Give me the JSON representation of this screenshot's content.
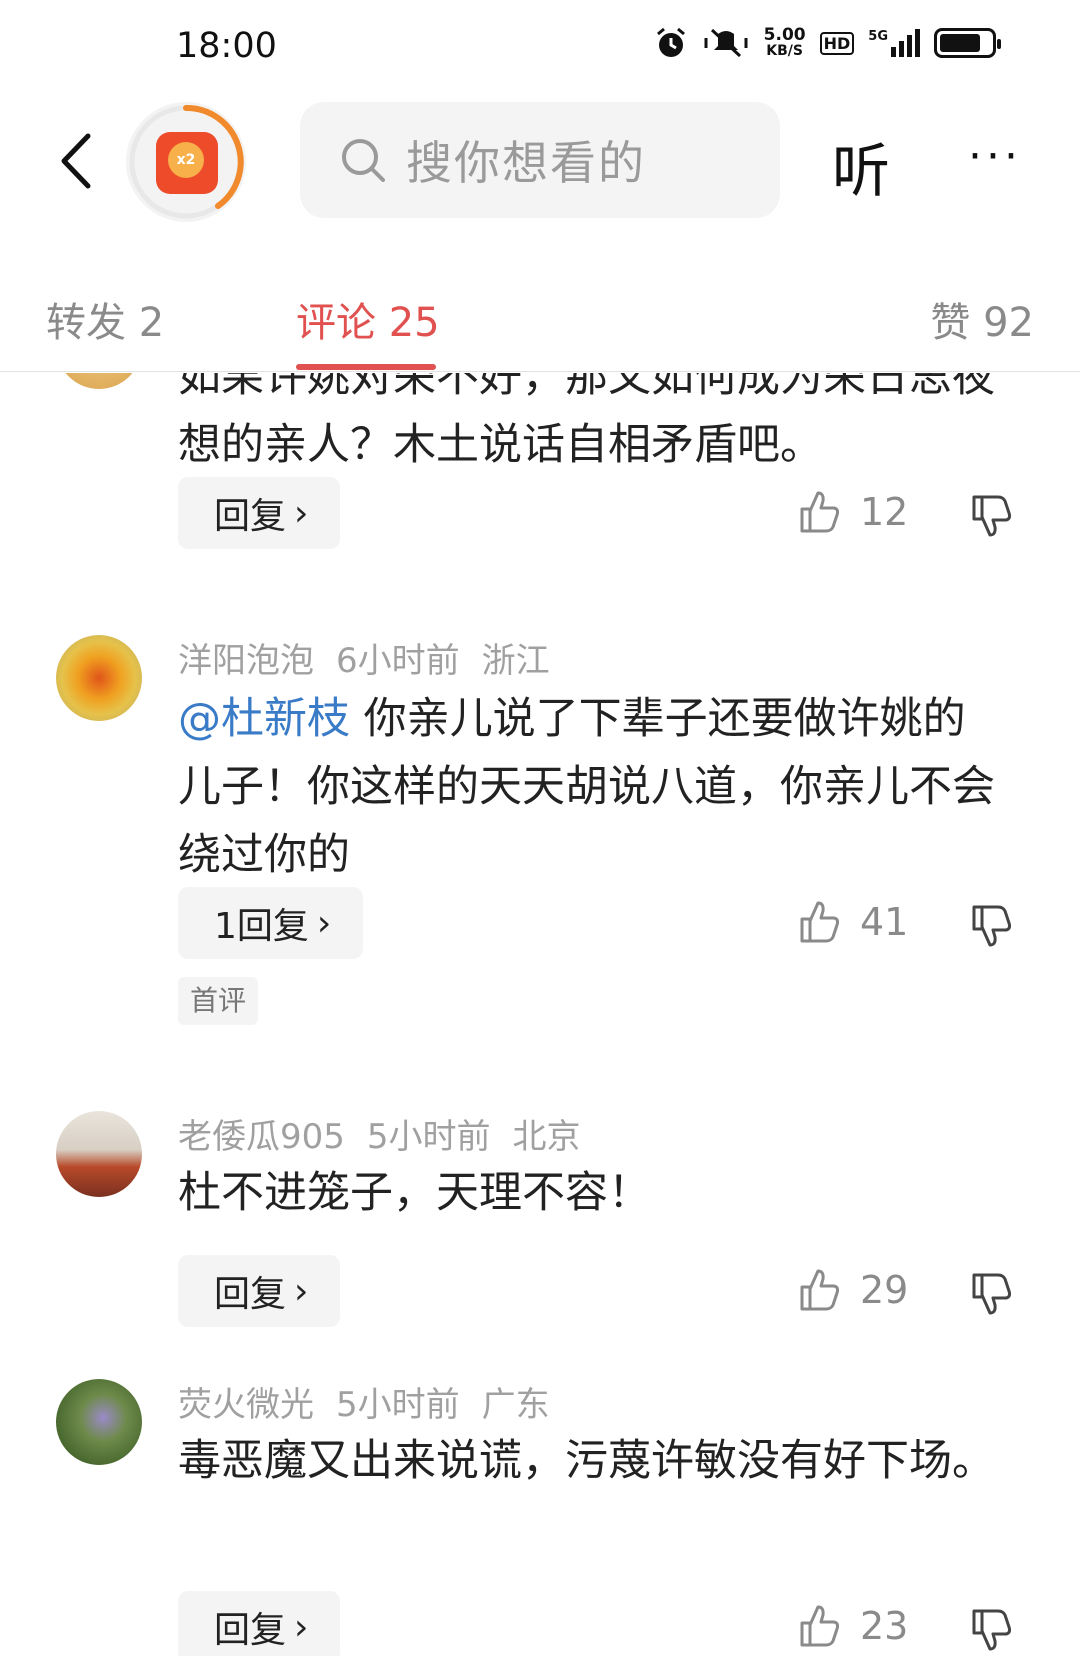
{
  "status_bar": {
    "time": "18:00",
    "net_speed_value": "5.00",
    "net_speed_unit": "KB/S",
    "hd": "HD",
    "network": "5G",
    "battery_level": 0.8
  },
  "top_nav": {
    "red_packet_label": "x2",
    "search_placeholder": "搜你想看的",
    "listen_label": "听",
    "more_label": "···"
  },
  "tabs": [
    {
      "label": "转发 2"
    },
    {
      "label": "评论 25"
    },
    {
      "label": "赞 92"
    }
  ],
  "comments": [
    {
      "text": "如果许姚对荣不好，那又如何成为荣日思夜想的亲人？木土说话自相矛盾吧。",
      "reply_label": "回复",
      "likes": "12"
    },
    {
      "user": "洋阳泡泡",
      "time": "6小时前",
      "location": "浙江",
      "mention": "@杜新枝",
      "text": " 你亲儿说了下辈子还要做许姚的儿子！你这样的天天胡说八道，你亲儿不会绕过你的",
      "reply_label": "1回复",
      "likes": "41",
      "badge": "首评"
    },
    {
      "user": "老倭瓜905",
      "time": "5小时前",
      "location": "北京",
      "text": "杜不进笼子，天理不容！",
      "reply_label": "回复",
      "likes": "29"
    },
    {
      "user": "荧火微光",
      "time": "5小时前",
      "location": "广东",
      "text": "毒恶魔又出来说谎，污蔑许敏没有好下场。",
      "reply_label": "回复",
      "likes": "23"
    }
  ],
  "colors": {
    "accent": "#e0514f",
    "mention": "#3a7bc8",
    "muted": "#a0a0a0"
  }
}
